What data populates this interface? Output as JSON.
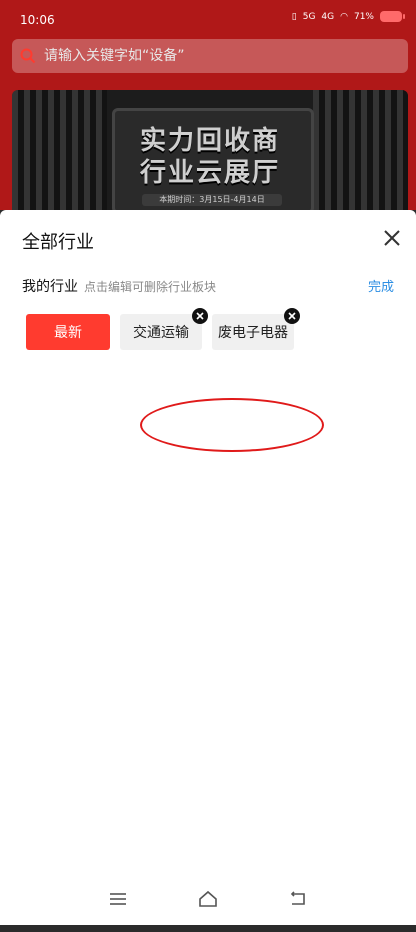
{
  "status_bar": {
    "time": "10:06",
    "signals": [
      "5G",
      "4G"
    ],
    "battery": "71%"
  },
  "search": {
    "placeholder": "请输入关键字如“设备”"
  },
  "banner": {
    "title_line1": "实力回收商",
    "title_line2": "行业云展厅",
    "date": "本期时间：3月15日-4月14日"
  },
  "sheet": {
    "title": "全部行业",
    "my_industry_label": "我的行业",
    "edit_hint": "点击编辑可删除行业板块",
    "done_label": "完成",
    "chips": [
      {
        "label": "最新"
      },
      {
        "label": "交通运输"
      },
      {
        "label": "废电子电器"
      }
    ]
  },
  "colors": {
    "accent": "#ff3b2f",
    "link": "#2c8ee3",
    "annotation": "#e01a1a"
  }
}
